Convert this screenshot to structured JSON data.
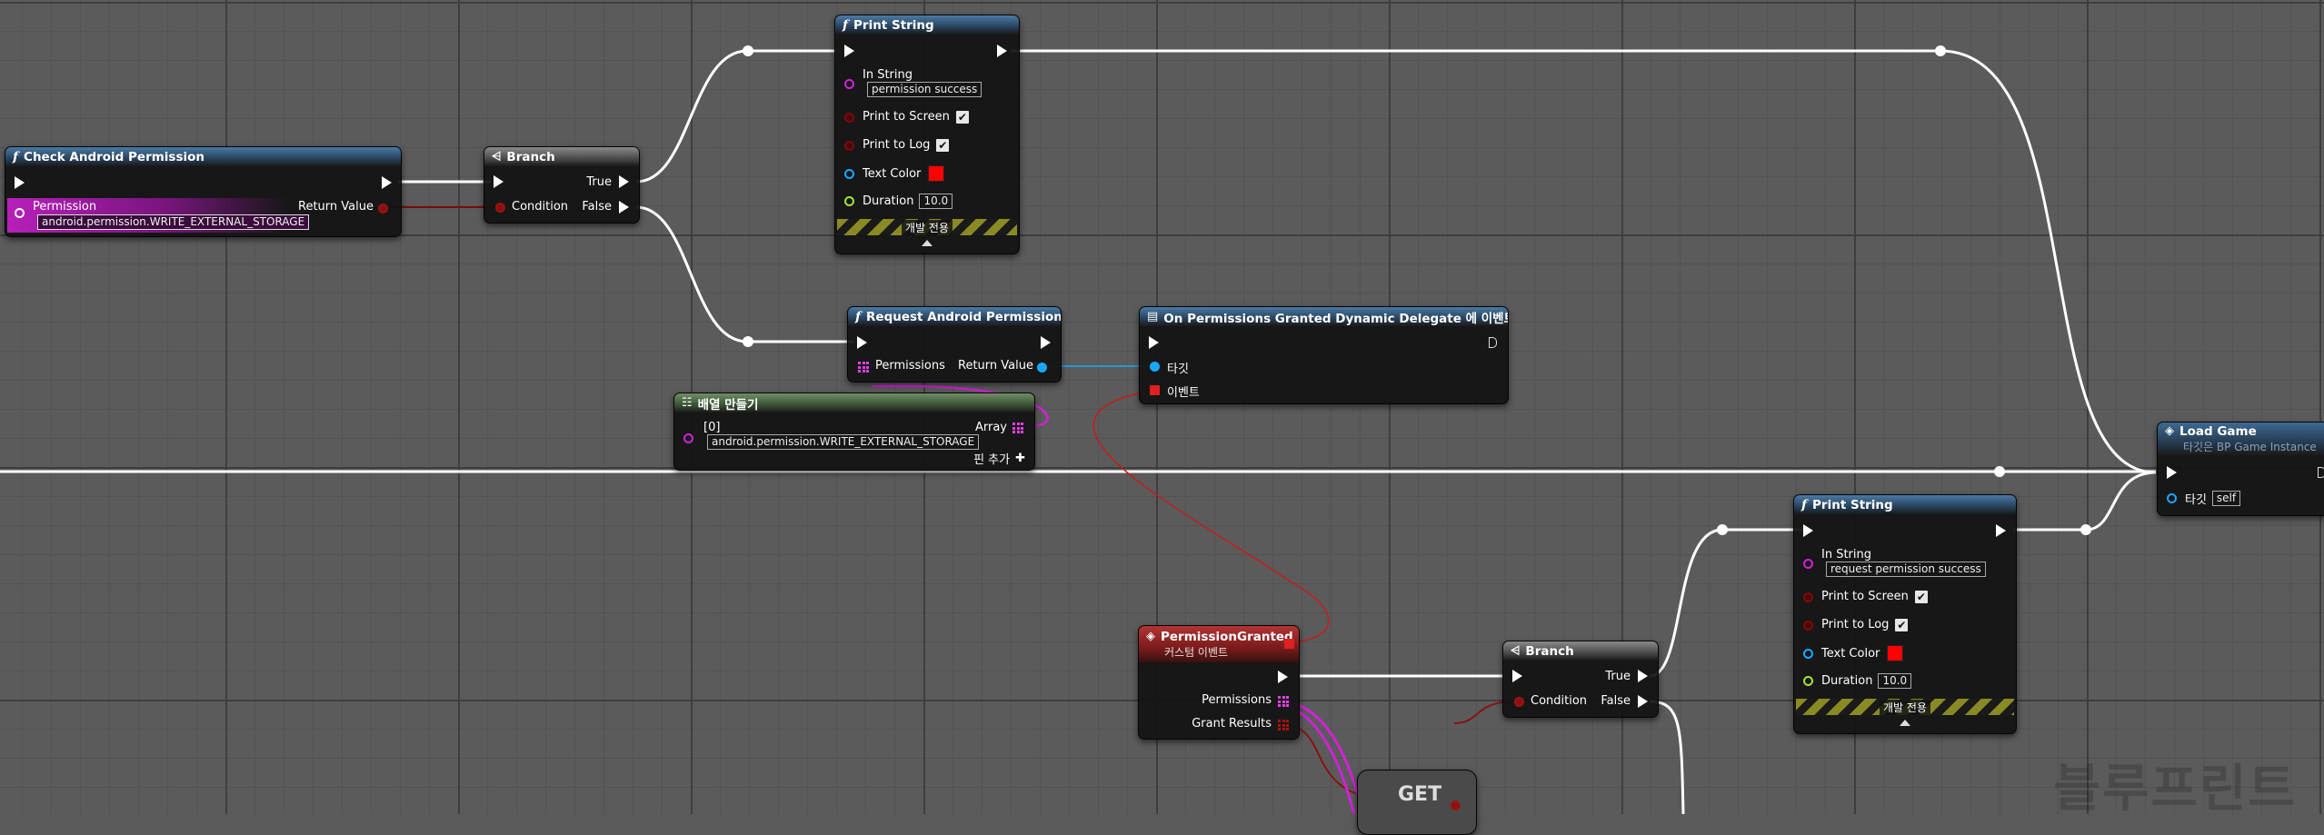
{
  "watermark": "블루프린트",
  "nodes": {
    "check_permission": {
      "title": "Check Android Permission",
      "icon": "function-icon",
      "permission_label": "Permission",
      "permission_value": "android.permission.WRITE_EXTERNAL_STORAGE",
      "return_label": "Return Value"
    },
    "branch1": {
      "title": "Branch",
      "true_label": "True",
      "false_label": "False",
      "condition_label": "Condition"
    },
    "print1": {
      "title": "Print String",
      "in_string_label": "In String",
      "in_string_value": "permission success",
      "print_screen_label": "Print to Screen",
      "print_log_label": "Print to Log",
      "text_color_label": "Text Color",
      "duration_label": "Duration",
      "duration_value": "10.0",
      "dev_only": "개발 전용"
    },
    "request": {
      "title": "Request Android Permissions",
      "permissions_label": "Permissions",
      "return_label": "Return Value"
    },
    "bind_delegate": {
      "title": "On Permissions Granted Dynamic Delegate 에 이벤트 바인딩",
      "target_label": "타깃",
      "event_label": "이벤트"
    },
    "make_array": {
      "title": "배열 만들기",
      "index_label": "[0]",
      "array_label": "Array",
      "value": "android.permission.WRITE_EXTERNAL_STORAGE",
      "add_pin_label": "핀 추가"
    },
    "load_game": {
      "title": "Load Game",
      "subtitle": "타깃은 BP Game Instance",
      "target_label": "타깃",
      "target_value": "self"
    },
    "print2": {
      "title": "Print String",
      "in_string_label": "In String",
      "in_string_value": "request permission success",
      "print_screen_label": "Print to Screen",
      "print_log_label": "Print to Log",
      "text_color_label": "Text Color",
      "duration_label": "Duration",
      "duration_value": "10.0",
      "dev_only": "개발 전용"
    },
    "custom_event": {
      "title": "PermissionGranted",
      "subtitle": "커스텀 이벤트",
      "permissions_label": "Permissions",
      "grant_label": "Grant Results"
    },
    "branch2": {
      "title": "Branch",
      "true_label": "True",
      "false_label": "False",
      "condition_label": "Condition"
    },
    "get_node": {
      "title": "GET"
    }
  },
  "colors": {
    "exec_wire": "#ffffff",
    "bool_wire": "#7c0b0b",
    "string_array_wire": "#d022d6",
    "object_wire": "#19a8ff",
    "delegate_wire": "#c61c1c"
  }
}
